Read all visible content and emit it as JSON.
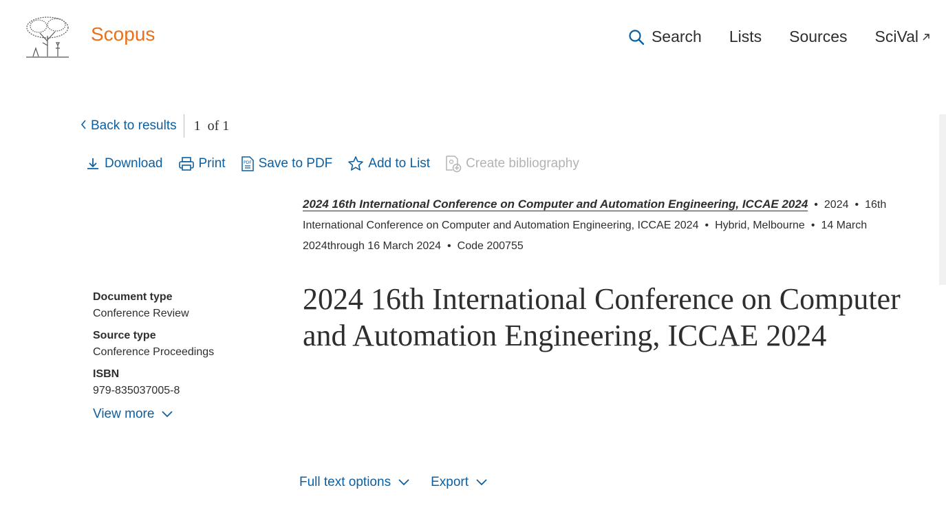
{
  "header": {
    "brand": "Scopus",
    "logo_icon": "elsevier-tree-logo",
    "nav": {
      "search": "Search",
      "lists": "Lists",
      "sources": "Sources",
      "scival": "SciVal"
    }
  },
  "results_nav": {
    "back": "Back to results",
    "pager": "1  of 1"
  },
  "toolbar": {
    "download": "Download",
    "print": "Print",
    "save_pdf": "Save to PDF",
    "add_to_list": "Add to List",
    "create_bibliography": "Create bibliography"
  },
  "source": {
    "title": "2024 16th International Conference on Computer and Automation Engineering, ICCAE 2024",
    "year": "2024",
    "conference": "16th International Conference on Computer and Automation Engineering, ICCAE 2024",
    "location": "Hybrid, Melbourne",
    "dates": "14 March 2024through 16 March 2024",
    "code": "Code 200755"
  },
  "meta": {
    "document_type_label": "Document type",
    "document_type": "Conference Review",
    "source_type_label": "Source type",
    "source_type": "Conference Proceedings",
    "isbn_label": "ISBN",
    "isbn": "979-835037005-8",
    "view_more": "View more"
  },
  "document": {
    "title": "2024 16th International Conference on Computer and Automation Engineering, ICCAE 2024"
  },
  "options": {
    "full_text": "Full text options",
    "export": "Export"
  },
  "colors": {
    "brand": "#e9711c",
    "link": "#0c5fa0",
    "text": "#2e2e2e",
    "disabled": "#b3b3b3"
  }
}
